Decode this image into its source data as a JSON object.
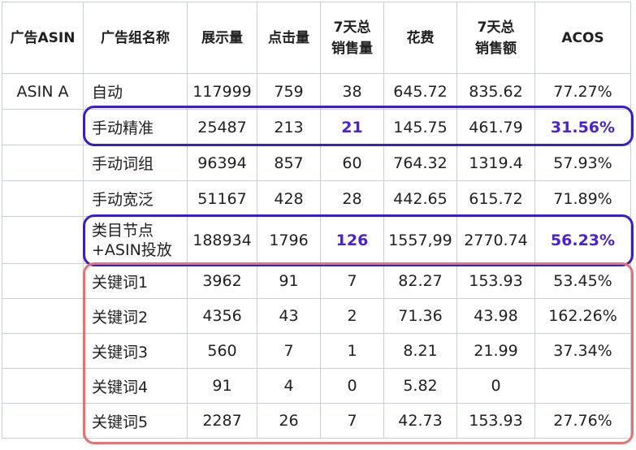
{
  "headers": [
    "广告ASIN",
    "广告组名称",
    "展示量",
    "点击量",
    "7天总\n销售量",
    "花费",
    "7天总\n销售额",
    "ACOS"
  ],
  "rows": [
    {
      "asin": "ASIN A",
      "name": "自动",
      "impressions": "117999",
      "clicks": "759",
      "units": "38",
      "spend": "645.72",
      "sales": "835.62",
      "acos": "77.27%"
    },
    {
      "asin": "",
      "name": "手动精准",
      "impressions": "25487",
      "clicks": "213",
      "units": "21",
      "spend": "145.75",
      "sales": "461.79",
      "acos": "31.56%"
    },
    {
      "asin": "",
      "name": "手动词组",
      "impressions": "96394",
      "clicks": "857",
      "units": "60",
      "spend": "764.32",
      "sales": "1319.4",
      "acos": "57.93%"
    },
    {
      "asin": "",
      "name": "手动宽泛",
      "impressions": "51167",
      "clicks": "428",
      "units": "28",
      "spend": "442.65",
      "sales": "615.72",
      "acos": "71.89%"
    },
    {
      "asin": "",
      "name": "类目节点\n+ASIN投放",
      "impressions": "188934",
      "clicks": "1796",
      "units": "126",
      "spend": "1557,99",
      "sales": "2770.74",
      "acos": "56.23%"
    },
    {
      "asin": "",
      "name": "关键词1",
      "impressions": "3962",
      "clicks": "91",
      "units": "7",
      "spend": "82.27",
      "sales": "153.93",
      "acos": "53.45%"
    },
    {
      "asin": "",
      "name": "关键词2",
      "impressions": "4356",
      "clicks": "43",
      "units": "2",
      "spend": "71.36",
      "sales": "43.98",
      "acos": "162.26%"
    },
    {
      "asin": "",
      "name": "关键词3",
      "impressions": "560",
      "clicks": "7",
      "units": "1",
      "spend": "8.21",
      "sales": "21.99",
      "acos": "37.34%"
    },
    {
      "asin": "",
      "name": "关键词4",
      "impressions": "91",
      "clicks": "4",
      "units": "0",
      "spend": "5.82",
      "sales": "0",
      "acos": ""
    },
    {
      "asin": "",
      "name": "关键词5",
      "impressions": "2287",
      "clicks": "26",
      "units": "7",
      "spend": "42.73",
      "sales": "153.93",
      "acos": "27.76%"
    }
  ],
  "highlight_colors": {
    "blue": "#3a1fc8",
    "red": "#e57373",
    "text": "#4a22d6"
  }
}
